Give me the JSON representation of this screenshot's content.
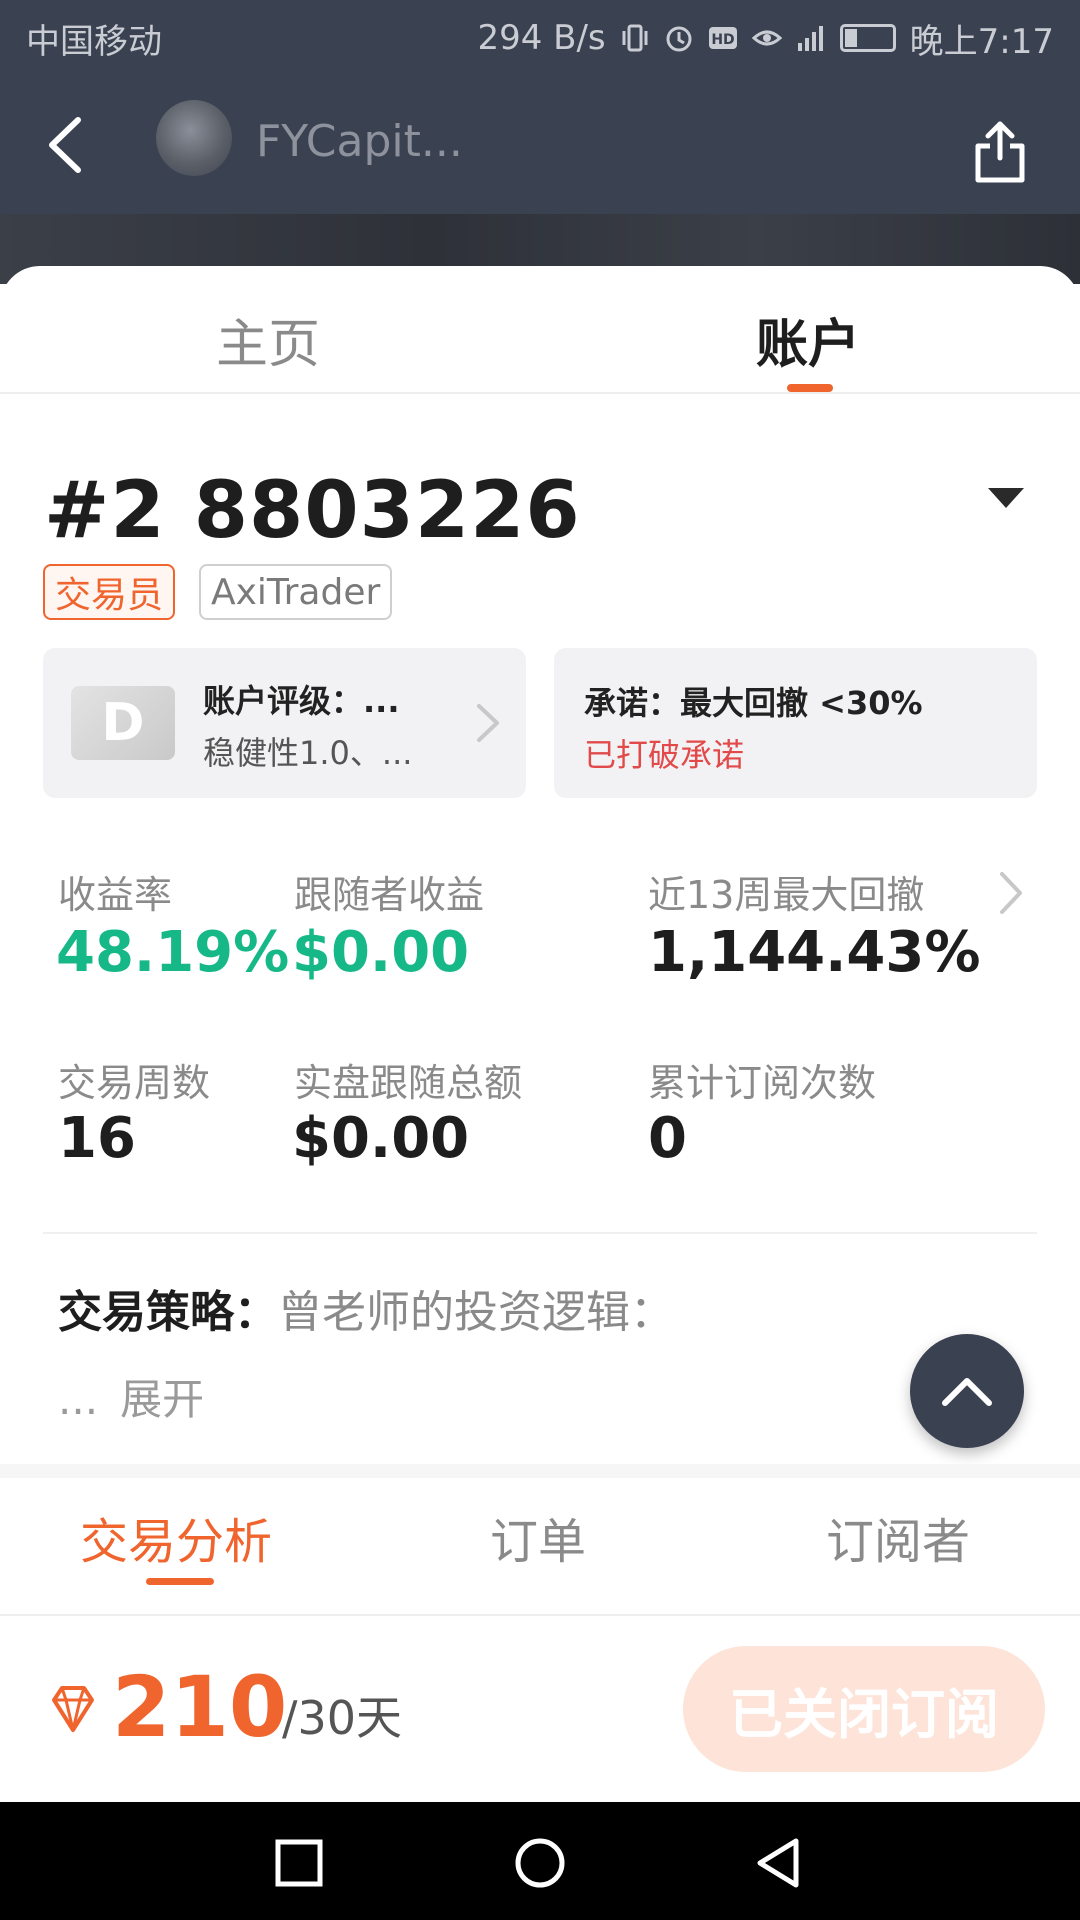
{
  "status_bar": {
    "carrier": "中国移动",
    "net_speed": "294 B/s",
    "time": "晚上7:17"
  },
  "header": {
    "title": "FYCapit..."
  },
  "tabs": {
    "home": "主页",
    "account": "账户"
  },
  "account": {
    "number": "#2 8803226",
    "tag_role": "交易员",
    "tag_broker": "AxiTrader"
  },
  "rating_card": {
    "grade": "D",
    "title": "账户评级：...",
    "subtitle": "稳健性1.0、..."
  },
  "promise_card": {
    "title": "承诺：最大回撤 <30%",
    "status": "已打破承诺"
  },
  "stats": {
    "return_rate": {
      "label": "收益率",
      "value": "48.19%"
    },
    "follower_profit": {
      "label": "跟随者收益",
      "value": "$0.00"
    },
    "max_drawdown_13w": {
      "label": "近13周最大回撤",
      "value": "1,144.43%"
    },
    "trading_weeks": {
      "label": "交易周数",
      "value": "16"
    },
    "live_follow_total": {
      "label": "实盘跟随总额",
      "value": "$0.00"
    },
    "subscribe_count": {
      "label": "累计订阅次数",
      "value": "0"
    }
  },
  "strategy": {
    "label": "交易策略：",
    "text": "曾老师的投资逻辑：",
    "ellipsis": "...",
    "expand": "展开"
  },
  "sub_tabs": {
    "analysis": "交易分析",
    "orders": "订单",
    "subscribers": "订阅者"
  },
  "bottom": {
    "price": "210",
    "period": "/30天",
    "button": "已关闭订阅"
  },
  "colors": {
    "accent": "#f0642d",
    "positive": "#17b887",
    "negative": "#e24a4a",
    "header_bg": "#3a4150"
  }
}
